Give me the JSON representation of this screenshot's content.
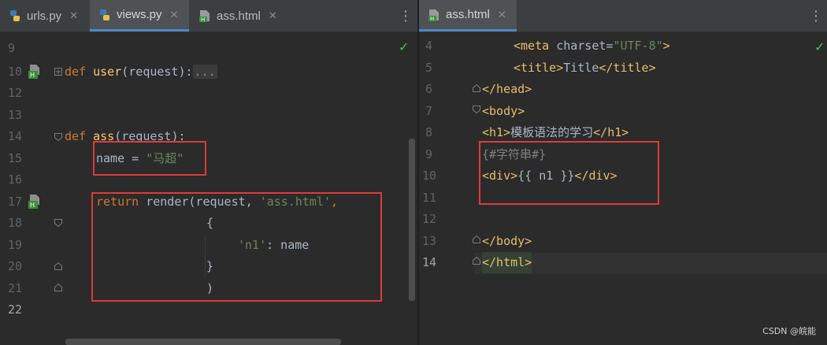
{
  "left_editor": {
    "tabs": [
      {
        "label": "urls.py",
        "icon": "python-file-icon",
        "closable": true,
        "active": false
      },
      {
        "label": "views.py",
        "icon": "python-file-icon",
        "closable": true,
        "active": true
      },
      {
        "label": "ass.html",
        "icon": "html-file-icon",
        "closable": true,
        "active": false
      }
    ],
    "line_numbers": [
      "9",
      "10",
      "12",
      "13",
      "14",
      "15",
      "16",
      "17",
      "18",
      "19",
      "20",
      "21",
      "22"
    ],
    "code": {
      "l10_def": "def ",
      "l10_name": "user",
      "l10_args": "(request):",
      "l10_folded": "...",
      "l14_def": "def ",
      "l14_name": "ass",
      "l14_args": "(request):",
      "l15_var": "name = ",
      "l15_str": "\"马超\"",
      "l17_return": "return ",
      "l17_call": "render(request, ",
      "l17_str": "'ass.html'",
      "l17_comma": ",",
      "l18": "{",
      "l19_key": "'n1'",
      "l19_rest": ": name",
      "l20": "}",
      "l21": ")"
    }
  },
  "right_editor": {
    "tabs": [
      {
        "label": "ass.html",
        "icon": "html-file-icon",
        "closable": true,
        "active": true
      }
    ],
    "line_numbers": [
      "4",
      "5",
      "6",
      "7",
      "8",
      "9",
      "10",
      "11",
      "12",
      "13",
      "14"
    ],
    "code": {
      "l4_open": "<meta ",
      "l4_attr": "charset=",
      "l4_val": "\"UTF-8\"",
      "l4_close": ">",
      "l5_open": "<title>",
      "l5_text": "Title",
      "l5_close": "</title>",
      "l6": "</head>",
      "l7": "<body>",
      "l8_open": "<h1>",
      "l8_text": "模板语法的学习",
      "l8_close": "</h1>",
      "l9": "{#字符串#}",
      "l10_open": "<div>",
      "l10_text": "{{ n1 }}",
      "l10_close": "</div>",
      "l13": "</body>",
      "l14": "</html>"
    }
  },
  "watermark": "CSDN @皖能",
  "colors": {
    "background": "#2b2b2b",
    "tab_bar": "#3c3f41",
    "keyword": "#cc7832",
    "function": "#ffc66d",
    "string": "#6a8759",
    "tag": "#e8bf6a",
    "highlight_box": "#e03a3a",
    "inspection_ok": "#5fb55c"
  }
}
